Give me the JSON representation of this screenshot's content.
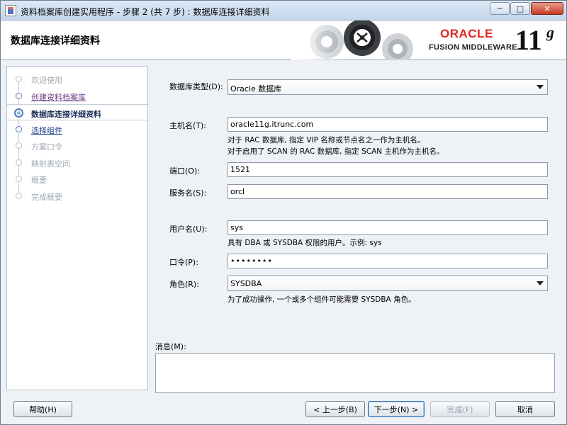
{
  "window": {
    "title": "资料档案库创建实用程序 - 步骤 2 (共 7 步) : 数据库连接详细资料",
    "minimize": "─",
    "maximize": "□",
    "close": "✕"
  },
  "header": {
    "title": "数据库连接详细资料",
    "brand_oracle": "ORACLE",
    "brand_product": "FUSION MIDDLEWARE",
    "brand_version": "11",
    "brand_version_suffix": "g"
  },
  "nav": {
    "items": [
      {
        "label": "欢迎使用",
        "state": "disabled"
      },
      {
        "label": "创建资料档案库",
        "state": "visited"
      },
      {
        "label": "数据库连接详细资料",
        "state": "current"
      },
      {
        "label": "选择组件",
        "state": "next"
      },
      {
        "label": "方案口令",
        "state": "disabled"
      },
      {
        "label": "映射表空间",
        "state": "disabled"
      },
      {
        "label": "概要",
        "state": "disabled"
      },
      {
        "label": "完成概要",
        "state": "disabled"
      }
    ]
  },
  "form": {
    "db_type_label": "数据库类型(D):",
    "db_type_value": "Oracle 数据库",
    "host_label": "主机名(T):",
    "host_value": "oracle11g.itrunc.com",
    "host_hint1": "对于 RAC 数据库, 指定 VIP 名称或节点名之一作为主机名。",
    "host_hint2": "对于启用了 SCAN 的 RAC 数据库, 指定 SCAN 主机作为主机名。",
    "port_label": "端口(O):",
    "port_value": "1521",
    "service_label": "服务名(S):",
    "service_value": "orcl",
    "username_label": "用户名(U):",
    "username_value": "sys",
    "username_hint": "具有 DBA 或 SYSDBA 权限的用户。示例: sys",
    "password_label": "口令(P):",
    "password_value": "••••••••",
    "role_label": "角色(R):",
    "role_value": "SYSDBA",
    "role_hint": "为了成功操作, 一个或多个组件可能需要 SYSDBA 角色。",
    "messages_label": "消息(M):"
  },
  "buttons": {
    "help": "帮助(H)",
    "back": "< 上一步(B)",
    "next": "下一步(N) >",
    "finish": "完成(F)",
    "cancel": "取消"
  }
}
